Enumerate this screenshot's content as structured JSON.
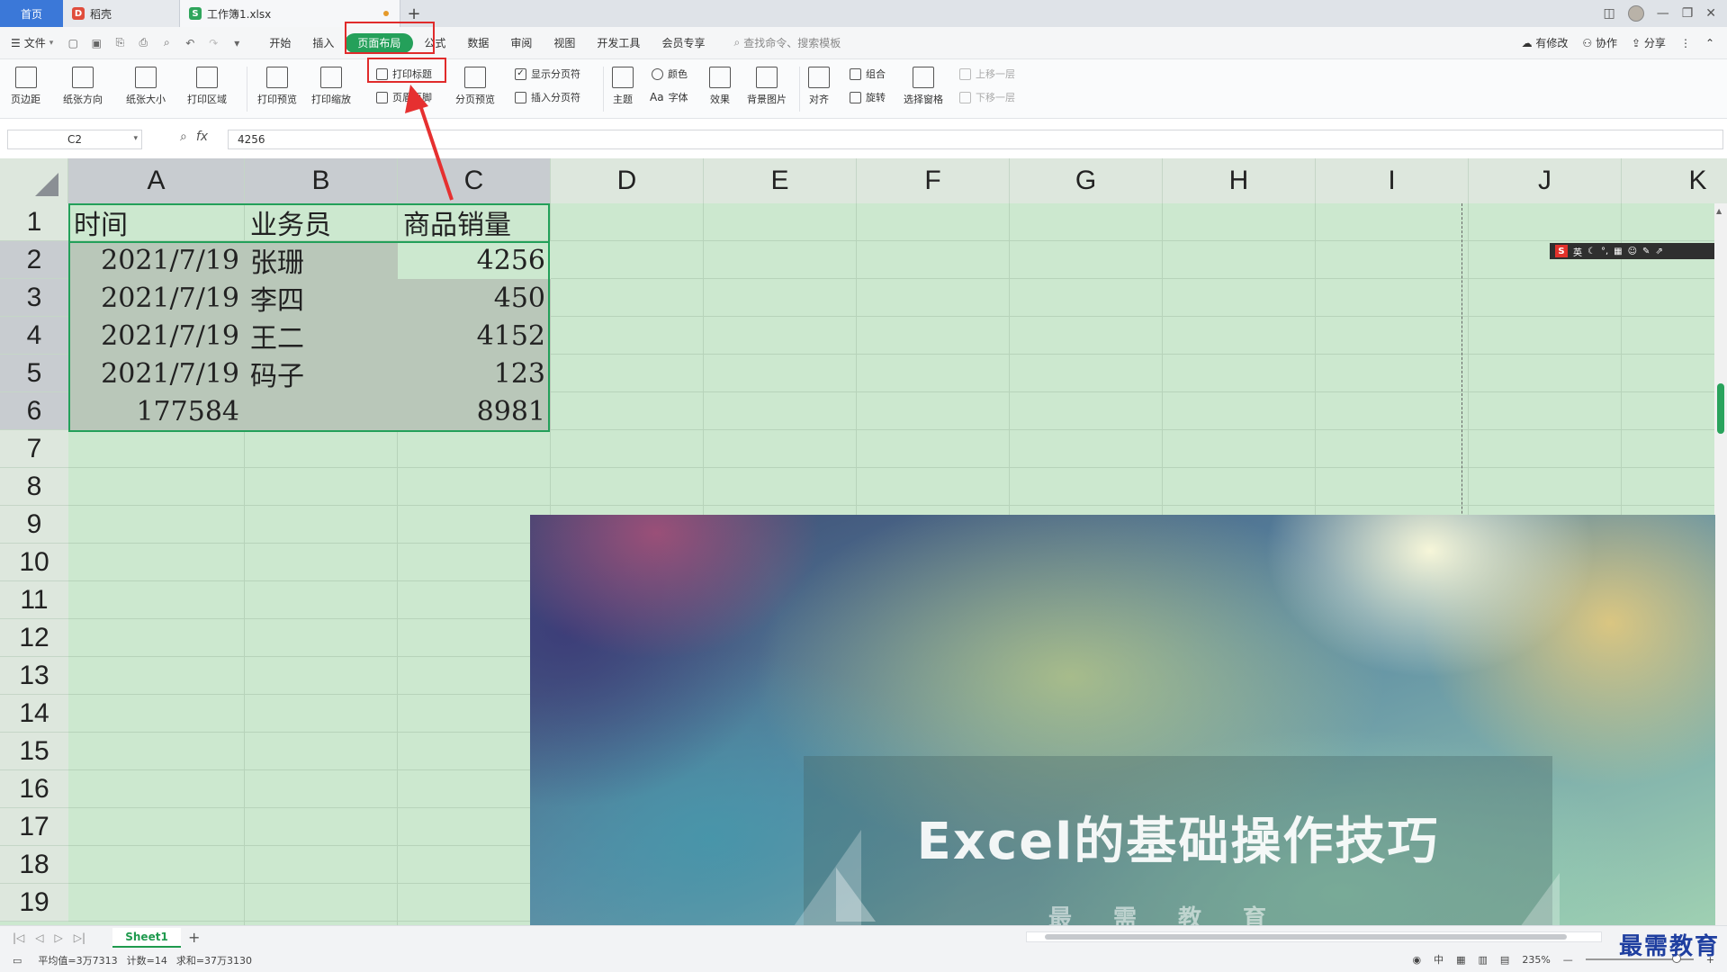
{
  "titlebar": {
    "home_tab": "首页",
    "tabs": [
      {
        "label": "稻壳",
        "icon": "daoke-icon"
      },
      {
        "label": "工作簿1.xlsx",
        "icon": "spreadsheet-icon"
      }
    ],
    "new_tab": "+"
  },
  "menubar": {
    "file": "文件",
    "items": [
      "开始",
      "插入",
      "页面布局",
      "公式",
      "数据",
      "审阅",
      "视图",
      "开发工具",
      "会员专享"
    ],
    "active": "页面布局",
    "search": "查找命令、搜索模板",
    "right": [
      "有修改",
      "协作",
      "分享"
    ]
  },
  "ribbon": {
    "page_margin": "页边距",
    "orientation": "纸张方向",
    "paper_size": "纸张大小",
    "print_area": "打印区域",
    "print_preview": "打印预览",
    "print_scale": "打印缩放",
    "print_titles": "打印标题",
    "header_footer": "页眉页脚",
    "page_break_preview": "分页预览",
    "show_page_breaks": "显示分页符",
    "insert_page_break": "插入分页符",
    "theme": "主题",
    "colors": "颜色",
    "fonts": "字体",
    "fonts_prefix": "Aa",
    "effects": "效果",
    "background": "背景图片",
    "align": "对齐",
    "group": "组合",
    "rotate": "旋转",
    "selection_pane": "选择窗格",
    "bring_forward": "上移一层",
    "send_backward": "下移一层"
  },
  "formula": {
    "name_box": "C2",
    "fx": "fx",
    "value": "4256"
  },
  "sheet": {
    "columns": [
      "A",
      "B",
      "C",
      "D",
      "E",
      "F",
      "G",
      "H",
      "I",
      "J",
      "K"
    ],
    "rows": [
      "1",
      "2",
      "3",
      "4",
      "5",
      "6",
      "7",
      "8",
      "9",
      "10",
      "11",
      "12",
      "13",
      "14",
      "15",
      "16",
      "17",
      "18",
      "19"
    ],
    "header": [
      "时间",
      "业务员",
      "商品销量"
    ],
    "data": [
      [
        "2021/7/19",
        "张珊",
        "4256"
      ],
      [
        "2021/7/19",
        "李四",
        "450"
      ],
      [
        "2021/7/19",
        "王二",
        "4152"
      ],
      [
        "2021/7/19",
        "码子",
        "123"
      ],
      [
        "177584",
        "",
        "8981"
      ]
    ],
    "tab": "Sheet1"
  },
  "ime": {
    "s": "S",
    "lang": "英"
  },
  "banner": {
    "title": "Excel的基础操作技巧",
    "subtitle": "最需教育"
  },
  "status": {
    "average": "平均值=3万7313",
    "count": "计数=14",
    "sum": "求和=37万3130",
    "lang": "中",
    "zoom": "235%"
  },
  "watermark": "最需教育",
  "colors": {
    "accent_green": "#24a05a",
    "highlight_red": "#e02b2b",
    "grid_bg": "#cce8cf"
  }
}
